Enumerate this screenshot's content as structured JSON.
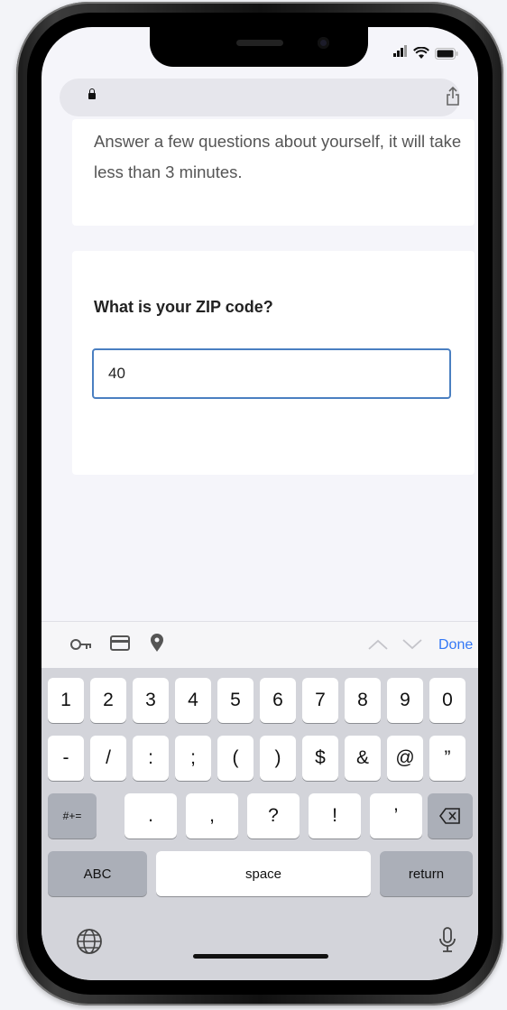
{
  "browser": {
    "lock_icon": "lock-icon",
    "share_icon": "share-icon"
  },
  "intro": {
    "text": "Answer a few questions about yourself, it will take less than 3 minutes."
  },
  "question": {
    "label": "What is your ZIP code?",
    "value": "40"
  },
  "keyboard_toolbar": {
    "icons": [
      "key-icon",
      "card-icon",
      "location-icon",
      "chevron-up-icon",
      "chevron-down-icon"
    ],
    "done_label": "Done"
  },
  "keyboard": {
    "row1": [
      "1",
      "2",
      "3",
      "4",
      "5",
      "6",
      "7",
      "8",
      "9",
      "0"
    ],
    "row2": [
      "-",
      "/",
      ":",
      ";",
      "(",
      ")",
      "$",
      "&",
      "@",
      "”"
    ],
    "row3_left": "#+=",
    "row3": [
      ".",
      ",",
      "?",
      "!",
      "’"
    ],
    "abc_label": "ABC",
    "space_label": "space",
    "return_label": "return",
    "accent": "#3478f6"
  }
}
